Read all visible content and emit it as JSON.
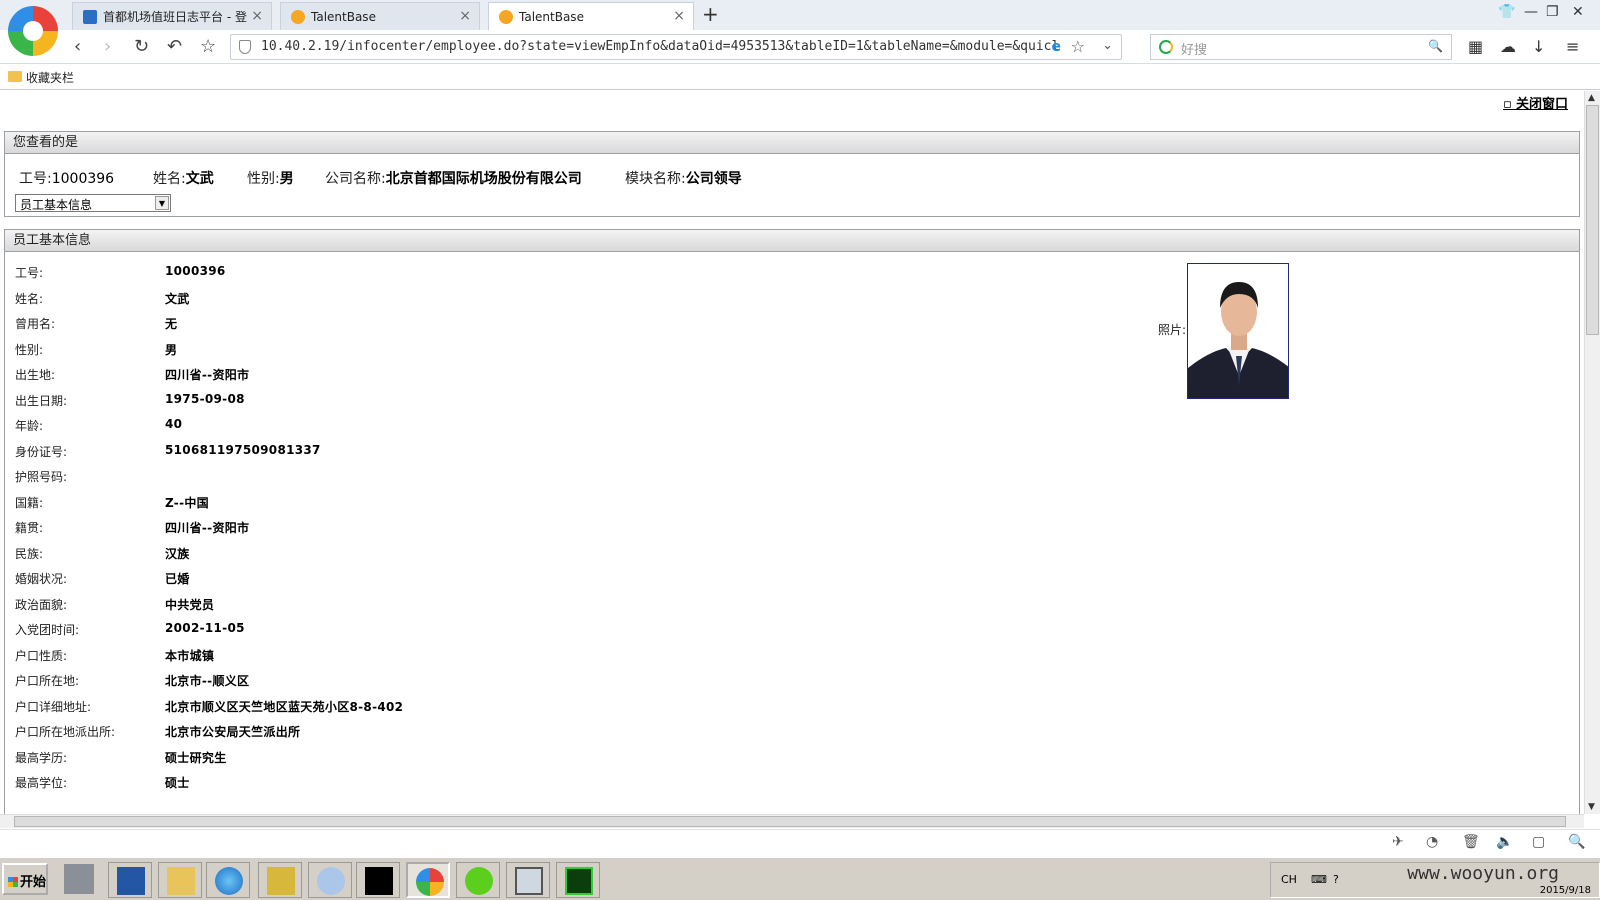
{
  "browser": {
    "tabs": [
      {
        "label": "首都机场值班日志平台 - 登"
      },
      {
        "label": "TalentBase"
      },
      {
        "label": "TalentBase"
      }
    ],
    "url": "10.40.2.19/infocenter/employee.do?state=viewEmpInfo&dataOid=4953513&tableID=1&tableName=&module=&quicl",
    "search_placeholder": "好搜",
    "favorites_label": "收藏夹栏"
  },
  "page": {
    "close_window": "关闭窗口",
    "viewing_panel_title": "您查看的是",
    "summary": {
      "emp_no_label": "工号:",
      "emp_no": "1000396",
      "name_label": "姓名:",
      "name": "文武",
      "gender_label": "性别:",
      "gender": "男",
      "company_label": "公司名称:",
      "company": "北京首都国际机场股份有限公司",
      "module_label": "模块名称:",
      "module": "公司领导"
    },
    "info_select": "员工基本信息",
    "basic_panel_title": "员工基本信息",
    "photo_label": "照片:",
    "fields": [
      {
        "label": "工号:",
        "value": "1000396"
      },
      {
        "label": "姓名:",
        "value": "文武"
      },
      {
        "label": "曾用名:",
        "value": "无"
      },
      {
        "label": "性别:",
        "value": "男"
      },
      {
        "label": "出生地:",
        "value": "四川省--资阳市"
      },
      {
        "label": "出生日期:",
        "value": "1975-09-08"
      },
      {
        "label": "年龄:",
        "value": "40"
      },
      {
        "label": "身份证号:",
        "value": "510681197509081337"
      },
      {
        "label": "护照号码:",
        "value": ""
      },
      {
        "label": "国籍:",
        "value": "Z--中国"
      },
      {
        "label": "籍贯:",
        "value": "四川省--资阳市"
      },
      {
        "label": "民族:",
        "value": "汉族"
      },
      {
        "label": "婚姻状况:",
        "value": "已婚"
      },
      {
        "label": "政治面貌:",
        "value": "中共党员"
      },
      {
        "label": "入党团时间:",
        "value": "2002-11-05"
      },
      {
        "label": "户口性质:",
        "value": "本市城镇"
      },
      {
        "label": "户口所在地:",
        "value": "北京市--顺义区"
      },
      {
        "label": "户口详细地址:",
        "value": "北京市顺义区天竺地区蓝天苑小区8-8-402"
      },
      {
        "label": "户口所在地派出所:",
        "value": "北京市公安局天竺派出所"
      },
      {
        "label": "最高学历:",
        "value": "硕士研究生"
      },
      {
        "label": "最高学位:",
        "value": "硕士"
      }
    ]
  },
  "taskbar": {
    "start_label": "开始",
    "tray_lang": "CH",
    "watermark": "www.wooyun.org",
    "date": "2015/9/18"
  }
}
